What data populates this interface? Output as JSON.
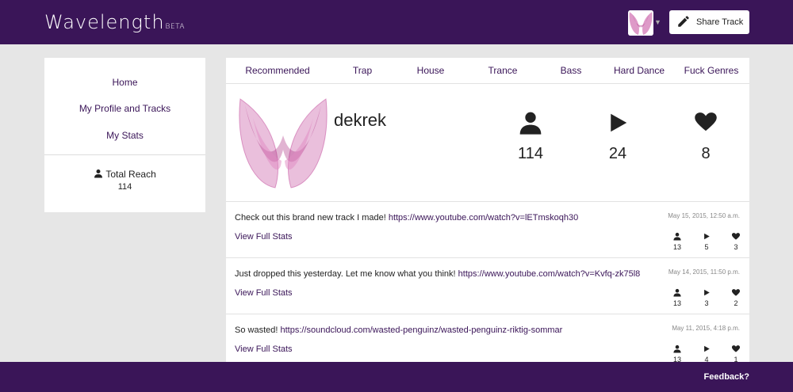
{
  "header": {
    "brand": "Wavelength",
    "beta": "BETA",
    "share_label": "Share Track"
  },
  "sidebar": {
    "items": [
      {
        "label": "Home"
      },
      {
        "label": "My Profile and Tracks"
      },
      {
        "label": "My Stats"
      }
    ],
    "reach_label": "Total Reach",
    "reach_value": "114"
  },
  "tabs": [
    "Recommended",
    "Trap",
    "House",
    "Trance",
    "Bass",
    "Hard Dance",
    "Fuck Genres"
  ],
  "profile": {
    "username": "dekrek",
    "followers": "114",
    "plays": "24",
    "likes": "8"
  },
  "posts": [
    {
      "text": "Check out this brand new track I made!",
      "url": "https://www.youtube.com/watch?v=lETmskoqh30",
      "date": "May 15, 2015, 12:50 a.m.",
      "link_label": "View Full Stats",
      "followers": "13",
      "plays": "5",
      "likes": "3"
    },
    {
      "text": "Just dropped this yesterday. Let me know what you think!",
      "url": "https://www.youtube.com/watch?v=Kvfq-zk75l8",
      "date": "May 14, 2015, 11:50 p.m.",
      "link_label": "View Full Stats",
      "followers": "13",
      "plays": "3",
      "likes": "2"
    },
    {
      "text": "So wasted!",
      "url": "https://soundcloud.com/wasted-penguinz/wasted-penguinz-riktig-sommar",
      "date": "May 11, 2015, 4:18 p.m.",
      "link_label": "View Full Stats",
      "followers": "13",
      "plays": "4",
      "likes": "1"
    }
  ],
  "footer": {
    "feedback": "Feedback?"
  },
  "icons": {
    "user": "user-icon",
    "play": "play-icon",
    "heart": "heart-icon",
    "pencil": "pencil-icon",
    "caret": "caret-down-icon"
  },
  "colors": {
    "brand_purple": "#3a1558",
    "background": "#e6e6e6",
    "logo_pink": "#c2479a"
  }
}
